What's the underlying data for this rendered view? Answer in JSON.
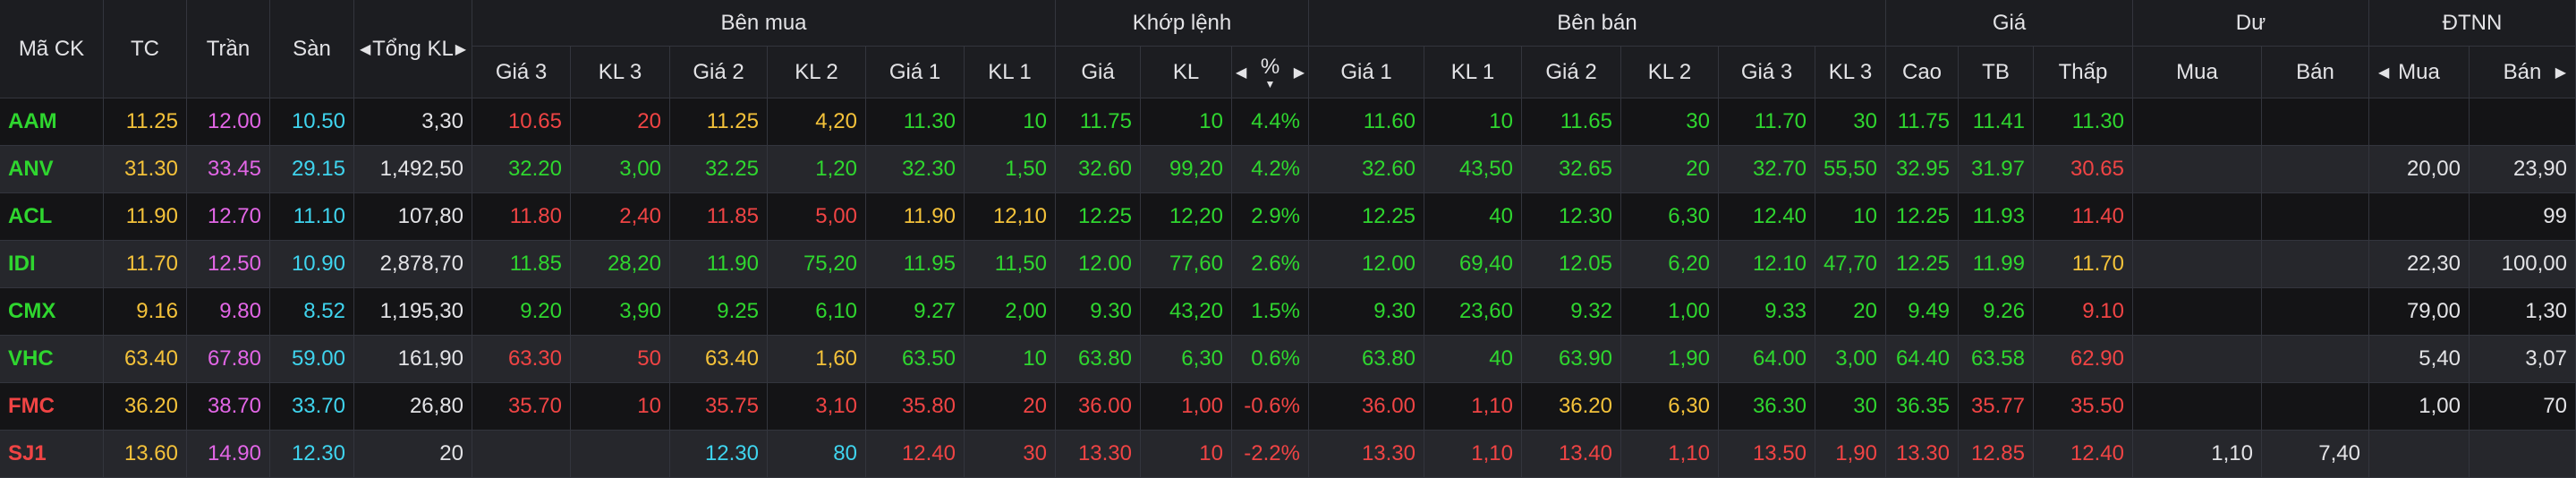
{
  "headers": {
    "ma_ck": "Mã CK",
    "tc": "TC",
    "tran": "Trần",
    "san": "Sàn",
    "tong_kl": "Tổng KL",
    "ben_mua": "Bên mua",
    "khop_lenh": "Khớp lệnh",
    "ben_ban": "Bên bán",
    "gia": "Giá",
    "du": "Dư",
    "dtnn": "ĐTNN",
    "gia3": "Giá 3",
    "kl3": "KL 3",
    "gia2": "Giá 2",
    "kl2": "KL 2",
    "gia1": "Giá 1",
    "kl1": "KL 1",
    "khop_gia": "Giá",
    "khop_kl": "KL",
    "khop_pct": "%",
    "cao": "Cao",
    "tb": "TB",
    "thap": "Thấp",
    "mua": "Mua",
    "ban": "Bán"
  },
  "icons": {
    "arrow_left": "◀",
    "arrow_right": "▶",
    "sort_desc": "▼"
  },
  "colors": {
    "ref": "#f4c23a",
    "ceiling": "#e266e6",
    "floor": "#3fd4ee",
    "up": "#2fd62f",
    "down": "#f04444"
  },
  "rows": [
    {
      "sym": "AAM",
      "tc": "11.25",
      "tran": "12.00",
      "san": "10.50",
      "tong": "3,30",
      "b_g3": "10.65",
      "b_k3": "20",
      "b_g2": "11.25",
      "b_k2": "4,20",
      "b_g1": "11.30",
      "b_k1": "10",
      "m_g": "11.75",
      "m_k": "10",
      "m_p": "4.4%",
      "s_g1": "11.60",
      "s_k1": "10",
      "s_g2": "11.65",
      "s_k2": "30",
      "s_g3": "11.70",
      "s_k3": "30",
      "cao": "11.75",
      "tb": "11.41",
      "thap": "11.30",
      "du_mua": "",
      "du_ban": "",
      "nn_mua": "",
      "nn_ban": "",
      "c": {
        "sym": "up",
        "b_g3": "down",
        "b_k3": "down",
        "b_g2": "eq",
        "b_k2": "eq",
        "b_g1": "up",
        "b_k1": "up",
        "m": "up",
        "s_g1": "up",
        "s_k1": "up",
        "s_g2": "up",
        "s_k2": "up",
        "s_g3": "up",
        "s_k3": "up",
        "cao": "up",
        "tb": "up",
        "thap": "up"
      }
    },
    {
      "sym": "ANV",
      "tc": "31.30",
      "tran": "33.45",
      "san": "29.15",
      "tong": "1,492,50",
      "b_g3": "32.20",
      "b_k3": "3,00",
      "b_g2": "32.25",
      "b_k2": "1,20",
      "b_g1": "32.30",
      "b_k1": "1,50",
      "m_g": "32.60",
      "m_k": "99,20",
      "m_p": "4.2%",
      "s_g1": "32.60",
      "s_k1": "43,50",
      "s_g2": "32.65",
      "s_k2": "20",
      "s_g3": "32.70",
      "s_k3": "55,50",
      "cao": "32.95",
      "tb": "31.97",
      "thap": "30.65",
      "du_mua": "",
      "du_ban": "",
      "nn_mua": "20,00",
      "nn_ban": "23,90",
      "c": {
        "sym": "up",
        "b_g3": "up",
        "b_k3": "up",
        "b_g2": "up",
        "b_k2": "up",
        "b_g1": "up",
        "b_k1": "up",
        "m": "up",
        "s_g1": "up",
        "s_k1": "up",
        "s_g2": "up",
        "s_k2": "up",
        "s_g3": "up",
        "s_k3": "up",
        "cao": "up",
        "tb": "up",
        "thap": "down"
      }
    },
    {
      "sym": "ACL",
      "tc": "11.90",
      "tran": "12.70",
      "san": "11.10",
      "tong": "107,80",
      "b_g3": "11.80",
      "b_k3": "2,40",
      "b_g2": "11.85",
      "b_k2": "5,00",
      "b_g1": "11.90",
      "b_k1": "12,10",
      "m_g": "12.25",
      "m_k": "12,20",
      "m_p": "2.9%",
      "s_g1": "12.25",
      "s_k1": "40",
      "s_g2": "12.30",
      "s_k2": "6,30",
      "s_g3": "12.40",
      "s_k3": "10",
      "cao": "12.25",
      "tb": "11.93",
      "thap": "11.40",
      "du_mua": "",
      "du_ban": "",
      "nn_mua": "",
      "nn_ban": "99",
      "c": {
        "sym": "up",
        "b_g3": "down",
        "b_k3": "down",
        "b_g2": "down",
        "b_k2": "down",
        "b_g1": "eq",
        "b_k1": "eq",
        "m": "up",
        "s_g1": "up",
        "s_k1": "up",
        "s_g2": "up",
        "s_k2": "up",
        "s_g3": "up",
        "s_k3": "up",
        "cao": "up",
        "tb": "up",
        "thap": "down"
      }
    },
    {
      "sym": "IDI",
      "tc": "11.70",
      "tran": "12.50",
      "san": "10.90",
      "tong": "2,878,70",
      "b_g3": "11.85",
      "b_k3": "28,20",
      "b_g2": "11.90",
      "b_k2": "75,20",
      "b_g1": "11.95",
      "b_k1": "11,50",
      "m_g": "12.00",
      "m_k": "77,60",
      "m_p": "2.6%",
      "s_g1": "12.00",
      "s_k1": "69,40",
      "s_g2": "12.05",
      "s_k2": "6,20",
      "s_g3": "12.10",
      "s_k3": "47,70",
      "cao": "12.25",
      "tb": "11.99",
      "thap": "11.70",
      "du_mua": "",
      "du_ban": "",
      "nn_mua": "22,30",
      "nn_ban": "100,00",
      "c": {
        "sym": "up",
        "b_g3": "up",
        "b_k3": "up",
        "b_g2": "up",
        "b_k2": "up",
        "b_g1": "up",
        "b_k1": "up",
        "m": "up",
        "s_g1": "up",
        "s_k1": "up",
        "s_g2": "up",
        "s_k2": "up",
        "s_g3": "up",
        "s_k3": "up",
        "cao": "up",
        "tb": "up",
        "thap": "eq"
      }
    },
    {
      "sym": "CMX",
      "tc": "9.16",
      "tran": "9.80",
      "san": "8.52",
      "tong": "1,195,30",
      "b_g3": "9.20",
      "b_k3": "3,90",
      "b_g2": "9.25",
      "b_k2": "6,10",
      "b_g1": "9.27",
      "b_k1": "2,00",
      "m_g": "9.30",
      "m_k": "43,20",
      "m_p": "1.5%",
      "s_g1": "9.30",
      "s_k1": "23,60",
      "s_g2": "9.32",
      "s_k2": "1,00",
      "s_g3": "9.33",
      "s_k3": "20",
      "cao": "9.49",
      "tb": "9.26",
      "thap": "9.10",
      "du_mua": "",
      "du_ban": "",
      "nn_mua": "79,00",
      "nn_ban": "1,30",
      "c": {
        "sym": "up",
        "b_g3": "up",
        "b_k3": "up",
        "b_g2": "up",
        "b_k2": "up",
        "b_g1": "up",
        "b_k1": "up",
        "m": "up",
        "s_g1": "up",
        "s_k1": "up",
        "s_g2": "up",
        "s_k2": "up",
        "s_g3": "up",
        "s_k3": "up",
        "cao": "up",
        "tb": "up",
        "thap": "down"
      }
    },
    {
      "sym": "VHC",
      "tc": "63.40",
      "tran": "67.80",
      "san": "59.00",
      "tong": "161,90",
      "b_g3": "63.30",
      "b_k3": "50",
      "b_g2": "63.40",
      "b_k2": "1,60",
      "b_g1": "63.50",
      "b_k1": "10",
      "m_g": "63.80",
      "m_k": "6,30",
      "m_p": "0.6%",
      "s_g1": "63.80",
      "s_k1": "40",
      "s_g2": "63.90",
      "s_k2": "1,90",
      "s_g3": "64.00",
      "s_k3": "3,00",
      "cao": "64.40",
      "tb": "63.58",
      "thap": "62.90",
      "du_mua": "",
      "du_ban": "",
      "nn_mua": "5,40",
      "nn_ban": "3,07",
      "c": {
        "sym": "up",
        "b_g3": "down",
        "b_k3": "down",
        "b_g2": "eq",
        "b_k2": "eq",
        "b_g1": "up",
        "b_k1": "up",
        "m": "up",
        "s_g1": "up",
        "s_k1": "up",
        "s_g2": "up",
        "s_k2": "up",
        "s_g3": "up",
        "s_k3": "up",
        "cao": "up",
        "tb": "up",
        "thap": "down"
      }
    },
    {
      "sym": "FMC",
      "tc": "36.20",
      "tran": "38.70",
      "san": "33.70",
      "tong": "26,80",
      "b_g3": "35.70",
      "b_k3": "10",
      "b_g2": "35.75",
      "b_k2": "3,10",
      "b_g1": "35.80",
      "b_k1": "20",
      "m_g": "36.00",
      "m_k": "1,00",
      "m_p": "-0.6%",
      "s_g1": "36.00",
      "s_k1": "1,10",
      "s_g2": "36.20",
      "s_k2": "6,30",
      "s_g3": "36.30",
      "s_k3": "30",
      "cao": "36.35",
      "tb": "35.77",
      "thap": "35.50",
      "du_mua": "",
      "du_ban": "",
      "nn_mua": "1,00",
      "nn_ban": "70",
      "c": {
        "sym": "down",
        "b_g3": "down",
        "b_k3": "down",
        "b_g2": "down",
        "b_k2": "down",
        "b_g1": "down",
        "b_k1": "down",
        "m": "down",
        "s_g1": "down",
        "s_k1": "down",
        "s_g2": "eq",
        "s_k2": "eq",
        "s_g3": "up",
        "s_k3": "up",
        "cao": "up",
        "tb": "down",
        "thap": "down"
      }
    },
    {
      "sym": "SJ1",
      "tc": "13.60",
      "tran": "14.90",
      "san": "12.30",
      "tong": "20",
      "b_g3": "",
      "b_k3": "",
      "b_g2": "12.30",
      "b_k2": "80",
      "b_g1": "12.40",
      "b_k1": "30",
      "m_g": "13.30",
      "m_k": "10",
      "m_p": "-2.2%",
      "s_g1": "13.30",
      "s_k1": "1,10",
      "s_g2": "13.40",
      "s_k2": "1,10",
      "s_g3": "13.50",
      "s_k3": "1,90",
      "cao": "13.30",
      "tb": "12.85",
      "thap": "12.40",
      "du_mua": "1,10",
      "du_ban": "7,40",
      "nn_mua": "",
      "nn_ban": "",
      "c": {
        "sym": "down",
        "b_g3": "down",
        "b_k3": "down",
        "b_g2": "floor",
        "b_k2": "floor",
        "b_g1": "down",
        "b_k1": "down",
        "m": "down",
        "s_g1": "down",
        "s_k1": "down",
        "s_g2": "down",
        "s_k2": "down",
        "s_g3": "down",
        "s_k3": "down",
        "cao": "down",
        "tb": "down",
        "thap": "down"
      }
    }
  ]
}
